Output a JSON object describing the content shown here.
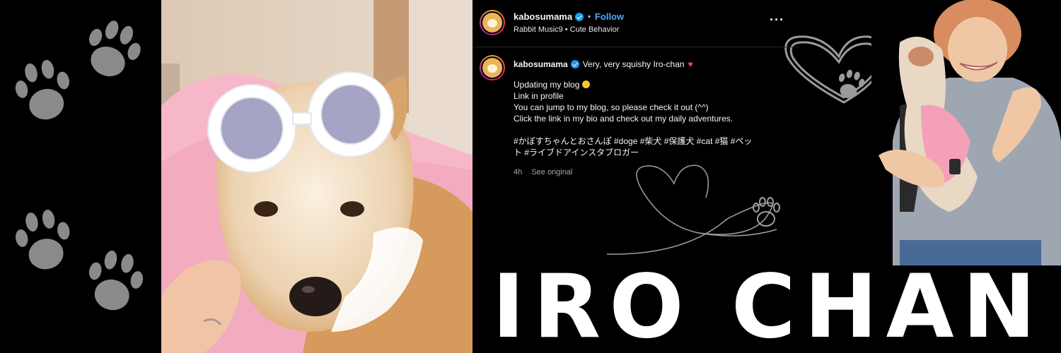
{
  "post": {
    "header": {
      "username": "kabosumama",
      "separator": "•",
      "follow_label": "Follow",
      "subtitle": "Rabbit Music9 • Cute Behavior",
      "more_label": "···"
    },
    "caption": {
      "username": "kabosumama",
      "title": "Very, very squishy Iro-chan",
      "title_emoji": "♥",
      "lines": [
        "Updating my blog",
        "Link in profile",
        "You can jump to my blog, so please check it out (^^)",
        "Click the link in my bio and check out my daily adventures.",
        "",
        "#かぼすちゃんとおさんぽ #doge #柴犬 #保護犬 #cat #猫 #ペッ",
        "ト #ライブドアインスタブロガー"
      ],
      "time": "4h",
      "see_original": "See original"
    }
  },
  "banner_title": "IRO CHAN",
  "icons": [
    "paw-print-icon",
    "verified-badge-icon",
    "more-options-icon",
    "heart-doodle-icon"
  ],
  "colors": {
    "background": "#000000",
    "follow": "#4aa8ff",
    "verified": "#1d9bf0",
    "paw": "#8a8a8a",
    "heart_emoji": "#ff3d6e"
  }
}
